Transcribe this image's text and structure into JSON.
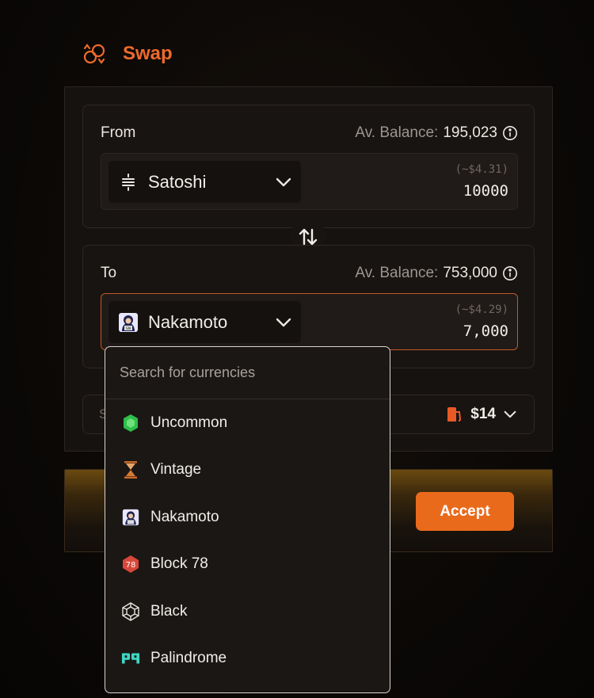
{
  "header": {
    "title": "Swap",
    "icon": "swap-circle-icon",
    "accent": "#ee6a2a"
  },
  "from": {
    "label": "From",
    "balance_label": "Av. Balance:",
    "balance_value": "195,023",
    "token": "Satoshi",
    "token_icon": "satoshi-icon",
    "usd_value": "(~$4.31)",
    "amount": "10000"
  },
  "to": {
    "label": "To",
    "balance_label": "Av. Balance:",
    "balance_value": "753,000",
    "token": "Nakamoto",
    "token_icon": "nakamoto-icon",
    "usd_value": "(~$4.29)",
    "amount": "7,000"
  },
  "fee": {
    "prefix": "S",
    "value": "$14",
    "icon": "gas-pump-icon"
  },
  "accept_label": "Accept",
  "dropdown": {
    "search_placeholder": "Search for currencies",
    "items": [
      {
        "label": "Uncommon",
        "icon": "green-gem-icon"
      },
      {
        "label": "Vintage",
        "icon": "hourglass-icon"
      },
      {
        "label": "Nakamoto",
        "icon": "nakamoto-icon"
      },
      {
        "label": "Block 78",
        "icon": "block-78-icon"
      },
      {
        "label": "Black",
        "icon": "black-gem-icon"
      },
      {
        "label": "Palindrome",
        "icon": "palindrome-icon"
      }
    ]
  }
}
